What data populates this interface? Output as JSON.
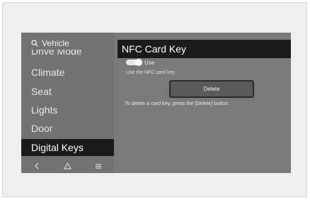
{
  "sidebar": {
    "search_label": "Vehicle",
    "items": [
      {
        "label": "Drive Mode"
      },
      {
        "label": "Climate"
      },
      {
        "label": "Seat"
      },
      {
        "label": "Lights"
      },
      {
        "label": "Door"
      },
      {
        "label": "Digital Keys"
      }
    ],
    "active_item": "Digital Keys",
    "bottom_bar": {
      "back_icon": "chevron-left-icon",
      "home_icon": "home-icon",
      "menu_icon": "menu-icon"
    }
  },
  "panel": {
    "title": "NFC Card Key",
    "toggle": {
      "label": "Use",
      "state": "on",
      "description": "Use the NFC card key"
    },
    "delete_button": "Delete",
    "delete_description": "To delete a card key, press the [Delete] button."
  }
}
